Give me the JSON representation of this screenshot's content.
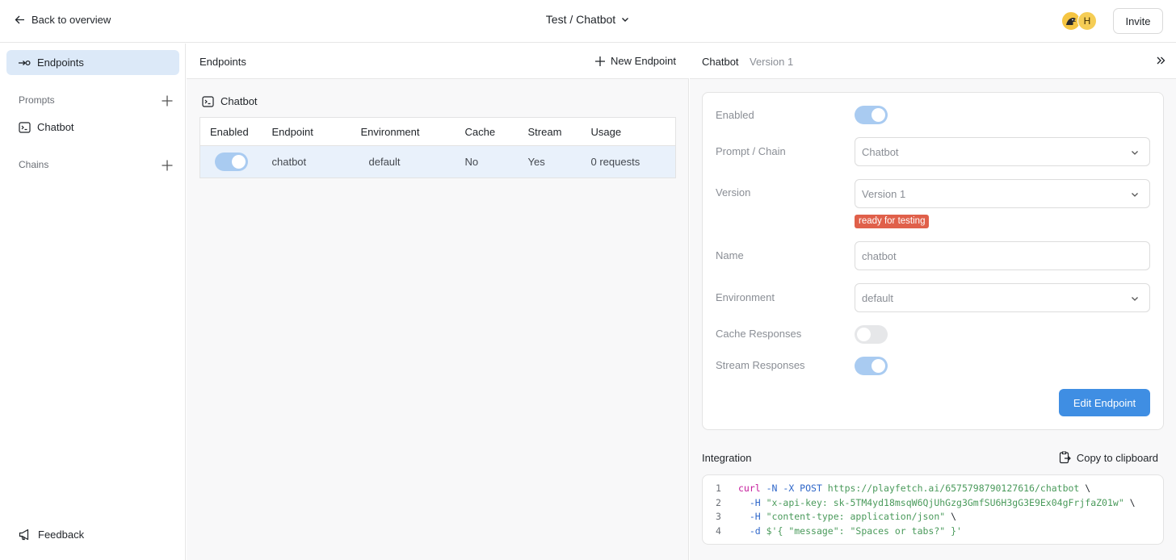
{
  "header": {
    "back_label": "Back to overview",
    "breadcrumb": "Test / Chatbot",
    "avatar_initial": "H",
    "invite_label": "Invite"
  },
  "sidebar": {
    "active_item": "Endpoints",
    "prompts_section": "Prompts",
    "prompt_items": [
      "Chatbot"
    ],
    "chains_section": "Chains",
    "feedback_label": "Feedback"
  },
  "endpoints_panel": {
    "title": "Endpoints",
    "new_endpoint_label": "New Endpoint",
    "group_label": "Chatbot",
    "columns": [
      "Enabled",
      "Endpoint",
      "Environment",
      "Cache",
      "Stream",
      "Usage"
    ],
    "rows": [
      {
        "enabled": true,
        "endpoint": "chatbot",
        "environment": "default",
        "cache": "No",
        "stream": "Yes",
        "usage": "0 requests"
      }
    ]
  },
  "detail_panel": {
    "title": "Chatbot",
    "version": "Version 1",
    "form": {
      "enabled_label": "Enabled",
      "enabled": true,
      "prompt_label": "Prompt / Chain",
      "prompt_value": "Chatbot",
      "version_label": "Version",
      "version_value": "Version 1",
      "version_badge": "ready for testing",
      "name_label": "Name",
      "name_placeholder": "chatbot",
      "environment_label": "Environment",
      "environment_value": "default",
      "cache_label": "Cache Responses",
      "cache_enabled": false,
      "stream_label": "Stream Responses",
      "stream_enabled": true,
      "submit_label": "Edit Endpoint"
    },
    "integration": {
      "title": "Integration",
      "copy_label": "Copy to clipboard",
      "code_lines": [
        {
          "n": "1",
          "parts": [
            [
              "kw",
              "curl"
            ],
            [
              "fl",
              " -N -X POST"
            ],
            [
              "st",
              " https://playfetch.ai/6575798790127616/chatbot"
            ],
            [
              "pl",
              " \\"
            ]
          ]
        },
        {
          "n": "2",
          "parts": [
            [
              "fl",
              "  -H"
            ],
            [
              "st",
              " \"x-api-key: sk-5TM4yd18msqW6QjUhGzg3GmfSU6H3gG3E9Ex04gFrjfaZ01w\""
            ],
            [
              "pl",
              " \\"
            ]
          ]
        },
        {
          "n": "3",
          "parts": [
            [
              "fl",
              "  -H"
            ],
            [
              "st",
              " \"content-type: application/json\""
            ],
            [
              "pl",
              " \\"
            ]
          ]
        },
        {
          "n": "4",
          "parts": [
            [
              "fl",
              "  -d"
            ],
            [
              "st",
              " $'{ \"message\": \"Spaces or tabs?\" }'"
            ]
          ]
        }
      ]
    }
  },
  "colors": {
    "accent": "#3f8ee3",
    "selection": "#dce9f8",
    "toggle_on": "#a9cbf1",
    "badge": "#e0604a"
  }
}
